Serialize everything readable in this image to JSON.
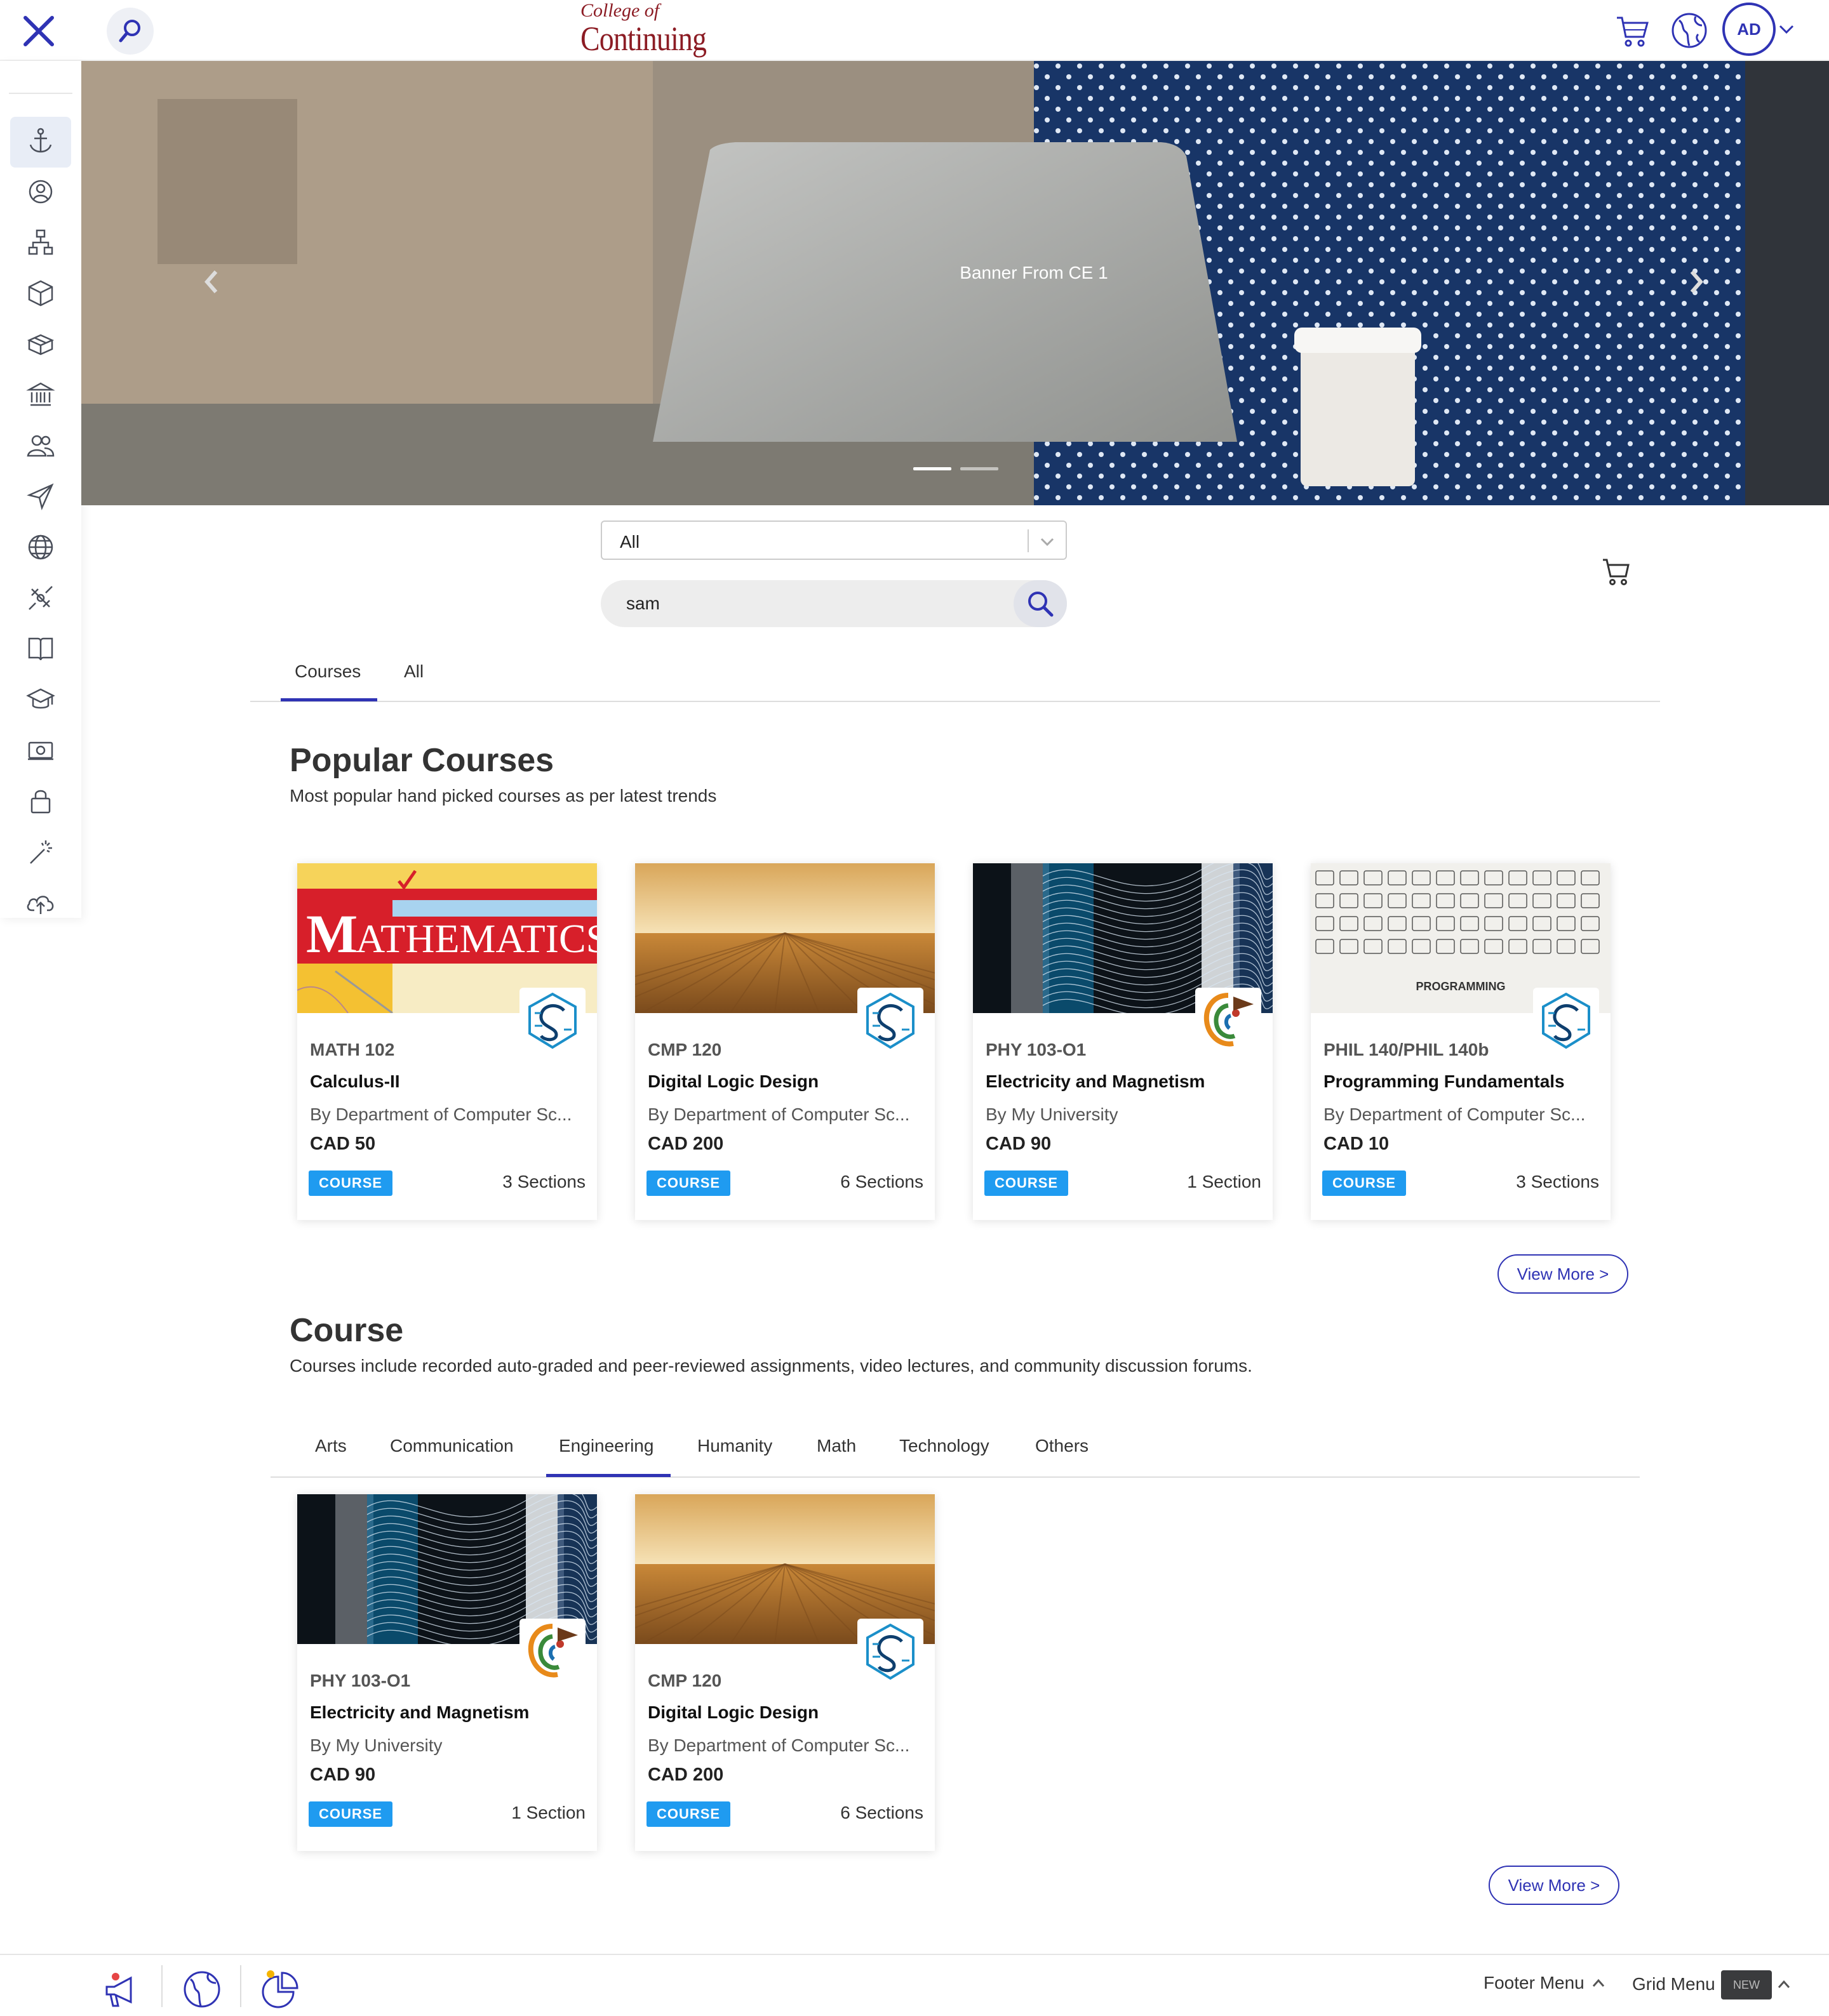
{
  "header": {
    "logo_small": "College of",
    "logo_big": "Continuing Studies",
    "avatar_initials": "AD",
    "accent_color": "#2f33b4",
    "logo_color": "#8c1c24"
  },
  "sidebar": {
    "items": [
      {
        "icon": "anchor-icon",
        "active": true
      },
      {
        "icon": "user-circle-icon"
      },
      {
        "icon": "hierarchy-icon"
      },
      {
        "icon": "box-icon"
      },
      {
        "icon": "package-icon"
      },
      {
        "icon": "institution-icon"
      },
      {
        "icon": "users-icon"
      },
      {
        "icon": "send-icon"
      },
      {
        "icon": "globe-icon"
      },
      {
        "icon": "satellite-icon"
      },
      {
        "icon": "book-icon"
      },
      {
        "icon": "graduation-cap-icon"
      },
      {
        "icon": "money-icon"
      },
      {
        "icon": "lock-icon"
      },
      {
        "icon": "magic-wand-icon"
      },
      {
        "icon": "cloud-upload-icon"
      }
    ]
  },
  "banner": {
    "title": "Banner From CE 1",
    "slides_count": 2,
    "active_slide": 1
  },
  "search": {
    "category_selected": "All",
    "query": "sam"
  },
  "result_tabs": [
    {
      "label": "Courses",
      "active": true
    },
    {
      "label": "All",
      "active": false
    }
  ],
  "popular": {
    "title": "Popular Courses",
    "subtitle": "Most popular hand picked courses as per latest trends",
    "view_more": "View More >",
    "cards": [
      {
        "image": "mathematics",
        "code": "MATH 102",
        "name": "Calculus-II",
        "by": "By Department of Computer Sc...",
        "price": "CAD 50",
        "badge": "COURSE",
        "sections": "3 Sections",
        "logo": "cs-logo"
      },
      {
        "image": "wood",
        "code": "CMP 120",
        "name": "Digital Logic Design",
        "by": "By Department of Computer Sc...",
        "price": "CAD 200",
        "badge": "COURSE",
        "sections": "6 Sections",
        "logo": "cs-logo"
      },
      {
        "image": "circuits",
        "code": "PHY 103-O1",
        "name": "Electricity and Magnetism",
        "by": "By My University",
        "price": "CAD 90",
        "badge": "COURSE",
        "sections": "1 Section",
        "logo": "uni-logo"
      },
      {
        "image": "programming",
        "code": "PHIL 140/PHIL 140b",
        "name": "Programming Fundamentals",
        "by": "By Department of Computer Sc...",
        "price": "CAD 10",
        "badge": "COURSE",
        "sections": "3 Sections",
        "logo": "cs-logo",
        "image_text": "PROGRAMMING"
      }
    ]
  },
  "course": {
    "title": "Course",
    "subtitle": "Courses include recorded auto-graded and peer-reviewed assignments, video lectures, and community discussion forums.",
    "view_more": "View More >",
    "tabs": [
      {
        "label": "Arts",
        "active": false
      },
      {
        "label": "Communication",
        "active": false
      },
      {
        "label": "Engineering",
        "active": true
      },
      {
        "label": "Humanity",
        "active": false
      },
      {
        "label": "Math",
        "active": false
      },
      {
        "label": "Technology",
        "active": false
      },
      {
        "label": "Others",
        "active": false
      }
    ],
    "cards": [
      {
        "image": "circuits",
        "code": "PHY 103-O1",
        "name": "Electricity and Magnetism",
        "by": "By My University",
        "price": "CAD 90",
        "badge": "COURSE",
        "sections": "1 Section",
        "logo": "uni-logo"
      },
      {
        "image": "wood",
        "code": "CMP 120",
        "name": "Digital Logic Design",
        "by": "By Department of Computer Sc...",
        "price": "CAD 200",
        "badge": "COURSE",
        "sections": "6 Sections",
        "logo": "cs-logo"
      }
    ]
  },
  "footer": {
    "footer_menu": "Footer Menu",
    "grid_menu": "Grid Menu",
    "new_badge": "NEW"
  }
}
